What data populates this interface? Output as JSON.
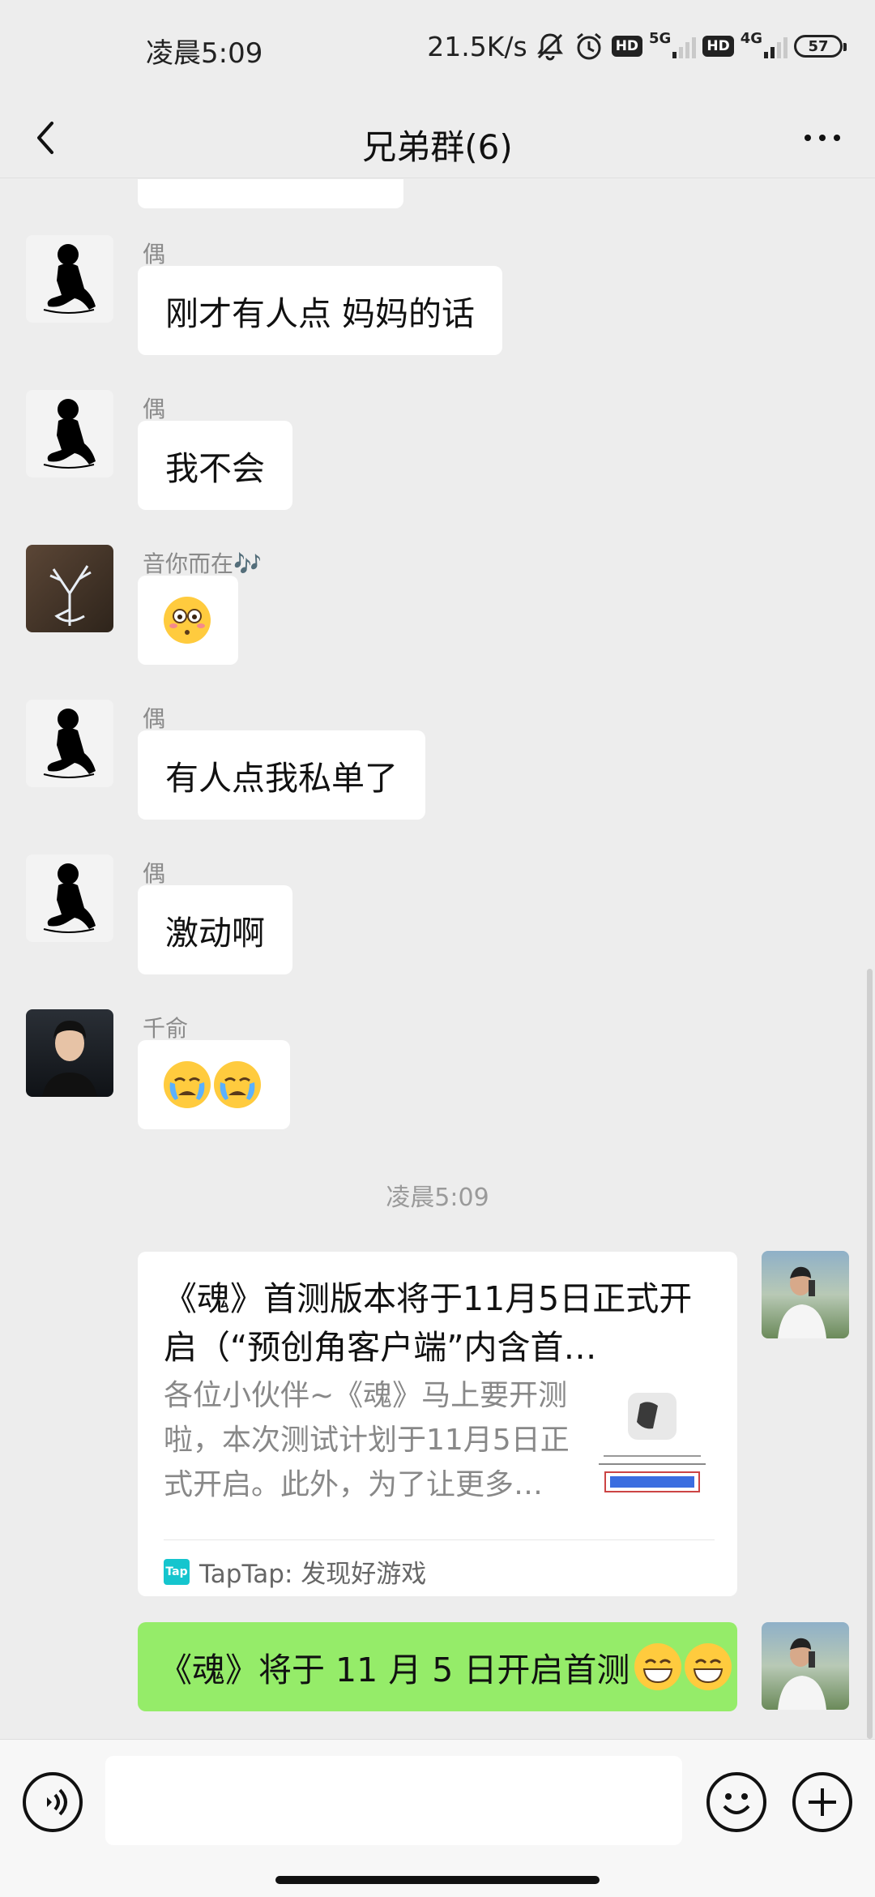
{
  "status_bar": {
    "time": "凌晨5:09",
    "net_speed": "21.5K/s",
    "hd1": "HD",
    "net1": "5G",
    "hd2": "HD",
    "net2": "4G",
    "battery": "57"
  },
  "header": {
    "title": "兄弟群(6)"
  },
  "messages": [
    {
      "sender": "偶",
      "text": "刚才有人点  妈妈的话"
    },
    {
      "sender": "偶",
      "text": "我不会"
    },
    {
      "sender": "音你而在🎶",
      "text": "",
      "emoji": [
        "flushed-face"
      ]
    },
    {
      "sender": "偶",
      "text": "有人点我私单了"
    },
    {
      "sender": "偶",
      "text": "激动啊"
    },
    {
      "sender": "千俞",
      "text": "",
      "emoji": [
        "crying-face",
        "crying-face"
      ]
    }
  ],
  "time_divider": "凌晨5:09",
  "link_card": {
    "title": "《魂》首测版本将于11月5日正式开启（“预创角客户端”内含首…",
    "description": "各位小伙伴~《魂》马上要开测啦，本次测试计划于11月5日正式开启。此外，为了让更多…",
    "source": "TapTap: 发现好游戏",
    "source_logo": "Tap"
  },
  "own_message": {
    "text": "《魂》将于 11 月 5 日开启首测",
    "emoji": [
      "grinning-face",
      "grinning-face"
    ]
  },
  "colors": {
    "background": "#ededed",
    "own_bubble": "#95ec69",
    "other_bubble": "#ffffff",
    "taptap": "#15c5ce"
  }
}
